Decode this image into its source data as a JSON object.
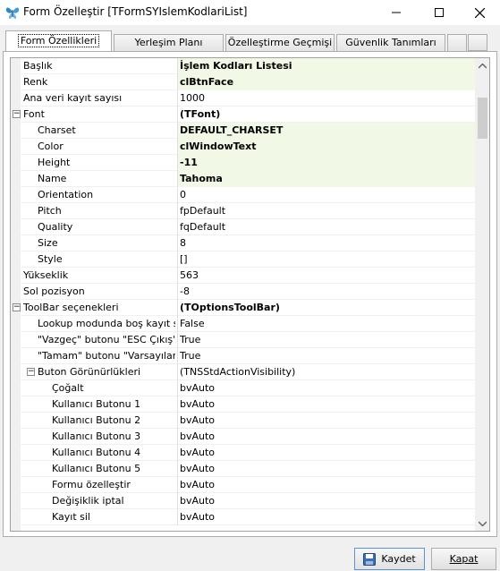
{
  "window": {
    "title": "Form Özelleştir [TFormSYIslemKodlariList]"
  },
  "tabs": [
    {
      "label": "Form Özellikleri",
      "active": true
    },
    {
      "label": "Yerleşim Planı",
      "active": false
    },
    {
      "label": "Özelleştirme Geçmişi",
      "active": false
    },
    {
      "label": "Güvenlik Tanımları",
      "active": false
    }
  ],
  "properties": [
    {
      "name": "Başlık",
      "value": "İşlem Kodları Listesi",
      "level": 0,
      "bold": true,
      "highlight": true
    },
    {
      "name": "Renk",
      "value": "clBtnFace",
      "level": 0,
      "bold": true,
      "highlight": true
    },
    {
      "name": "Ana veri kayıt sayısı",
      "value": "1000",
      "level": 0,
      "bold": false,
      "highlight": false
    },
    {
      "name": "Font",
      "value": "(TFont)",
      "level": 0,
      "bold": true,
      "highlight": false,
      "expander": "−"
    },
    {
      "name": "Charset",
      "value": "DEFAULT_CHARSET",
      "level": 1,
      "bold": true,
      "highlight": true
    },
    {
      "name": "Color",
      "value": "clWindowText",
      "level": 1,
      "bold": true,
      "highlight": true
    },
    {
      "name": "Height",
      "value": "-11",
      "level": 1,
      "bold": true,
      "highlight": true
    },
    {
      "name": "Name",
      "value": "Tahoma",
      "level": 1,
      "bold": true,
      "highlight": true
    },
    {
      "name": "Orientation",
      "value": "0",
      "level": 1,
      "bold": false,
      "highlight": false
    },
    {
      "name": "Pitch",
      "value": "fpDefault",
      "level": 1,
      "bold": false,
      "highlight": false
    },
    {
      "name": "Quality",
      "value": "fqDefault",
      "level": 1,
      "bold": false,
      "highlight": false
    },
    {
      "name": "Size",
      "value": "8",
      "level": 1,
      "bold": false,
      "highlight": false
    },
    {
      "name": "Style",
      "value": "[]",
      "level": 1,
      "bold": false,
      "highlight": false
    },
    {
      "name": "Yükseklik",
      "value": "563",
      "level": 0,
      "bold": false,
      "highlight": false
    },
    {
      "name": "Sol pozisyon",
      "value": "-8",
      "level": 0,
      "bold": false,
      "highlight": false
    },
    {
      "name": "ToolBar seçenekleri",
      "value": "(TOptionsToolBar)",
      "level": 0,
      "bold": true,
      "highlight": false,
      "expander": "−"
    },
    {
      "name": "Lookup modunda boş kayıt seç",
      "value": "False",
      "level": 1,
      "bold": false,
      "highlight": false
    },
    {
      "name": "\"Vazgeç\" butonu \"ESC Çıkış\"",
      "value": "True",
      "level": 1,
      "bold": false,
      "highlight": false
    },
    {
      "name": "\"Tamam\" butonu \"Varsayılan\"",
      "value": "True",
      "level": 1,
      "bold": false,
      "highlight": false
    },
    {
      "name": "Buton Görünürlükleri",
      "value": "(TNSStdActionVisibility)",
      "level": 1,
      "bold": false,
      "highlight": false,
      "expander": "−"
    },
    {
      "name": "Çoğalt",
      "value": "bvAuto",
      "level": 2,
      "bold": false,
      "highlight": false
    },
    {
      "name": "Kullanıcı Butonu 1",
      "value": "bvAuto",
      "level": 2,
      "bold": false,
      "highlight": false
    },
    {
      "name": "Kullanıcı Butonu 2",
      "value": "bvAuto",
      "level": 2,
      "bold": false,
      "highlight": false
    },
    {
      "name": "Kullanıcı Butonu 3",
      "value": "bvAuto",
      "level": 2,
      "bold": false,
      "highlight": false
    },
    {
      "name": "Kullanıcı Butonu 4",
      "value": "bvAuto",
      "level": 2,
      "bold": false,
      "highlight": false
    },
    {
      "name": "Kullanıcı Butonu 5",
      "value": "bvAuto",
      "level": 2,
      "bold": false,
      "highlight": false
    },
    {
      "name": "Formu özelleştir",
      "value": "bvAuto",
      "level": 2,
      "bold": false,
      "highlight": false
    },
    {
      "name": "Değişiklik iptal",
      "value": "bvAuto",
      "level": 2,
      "bold": false,
      "highlight": false
    },
    {
      "name": "Kayıt sil",
      "value": "bvAuto",
      "level": 2,
      "bold": false,
      "highlight": false
    }
  ],
  "footer": {
    "save_label": "Kaydet",
    "close_label": "Kapat"
  },
  "icons": {
    "app": "butterfly-icon",
    "save": "floppy-disk-icon"
  }
}
